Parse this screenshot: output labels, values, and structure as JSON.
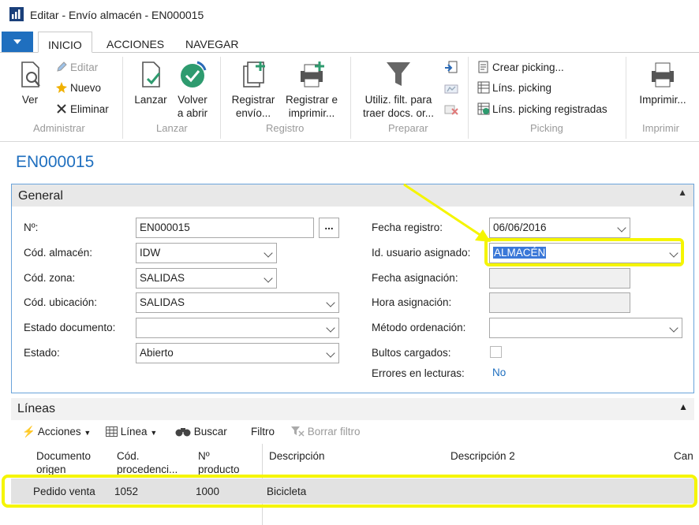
{
  "window": {
    "title": "Editar - Envío almacén - EN000015"
  },
  "tabs": [
    "INICIO",
    "ACCIONES",
    "NAVEGAR"
  ],
  "ribbon": {
    "ver": "Ver",
    "editar": "Editar",
    "nuevo": "Nuevo",
    "eliminar": "Eliminar",
    "administrar": "Administrar",
    "lanzar": "Lanzar",
    "volver_a": "Volver",
    "volver_b": "a abrir",
    "lanzar_grp": "Lanzar",
    "reg_envio_a": "Registrar",
    "reg_envio_b": "envío...",
    "reg_impr_a": "Registrar e",
    "reg_impr_b": "imprimir...",
    "registro": "Registro",
    "utiliz_a": "Utiliz. filt. para",
    "utiliz_b": "traer docs. or...",
    "preparar": "Preparar",
    "crear_picking": "Crear picking...",
    "lins_picking": "Líns. picking",
    "lins_picking_reg": "Líns. picking registradas",
    "picking": "Picking",
    "imprimir_btn": "Imprimir...",
    "imprimir": "Imprimir"
  },
  "doc_title": "EN000015",
  "general": {
    "header": "General",
    "no_label": "Nº:",
    "no_value": "EN000015",
    "lookup": "...",
    "almacen_label": "Cód. almacén:",
    "almacen_value": "IDW",
    "zona_label": "Cód. zona:",
    "zona_value": "SALIDAS",
    "ubicacion_label": "Cód. ubicación:",
    "ubicacion_value": "SALIDAS",
    "estado_doc_label": "Estado documento:",
    "estado_doc_value": "",
    "estado_label": "Estado:",
    "estado_value": "Abierto",
    "fecha_reg_label": "Fecha registro:",
    "fecha_reg_value": "06/06/2016",
    "usuario_label": "Id. usuario asignado:",
    "usuario_value": "ALMACÉN",
    "fecha_asig_label": "Fecha asignación:",
    "fecha_asig_value": "",
    "hora_asig_label": "Hora asignación:",
    "hora_asig_value": "",
    "metodo_label": "Método ordenación:",
    "metodo_value": "",
    "bultos_label": "Bultos cargados:",
    "errores_label": "Errores en lecturas:",
    "errores_value": "No"
  },
  "lineas": {
    "header": "Líneas",
    "toolbar": {
      "acciones": "Acciones",
      "linea": "Línea",
      "buscar": "Buscar",
      "filtro": "Filtro",
      "borrar_filtro": "Borrar filtro"
    },
    "columns": [
      [
        "Documento",
        "origen"
      ],
      [
        "Cód.",
        "procedenci..."
      ],
      [
        "Nº",
        "producto"
      ],
      [
        "Descripción"
      ],
      [
        "Descripción 2"
      ],
      [
        "Can"
      ]
    ],
    "rows": [
      {
        "doc_origen": "Pedido venta",
        "cod_proc": "1052",
        "no_producto": "1000",
        "descripcion": "Bicicleta"
      }
    ]
  },
  "colors": {
    "accent": "#1f6fbf",
    "highlight": "#f5f500",
    "excel_green": "#2e9b6f"
  }
}
